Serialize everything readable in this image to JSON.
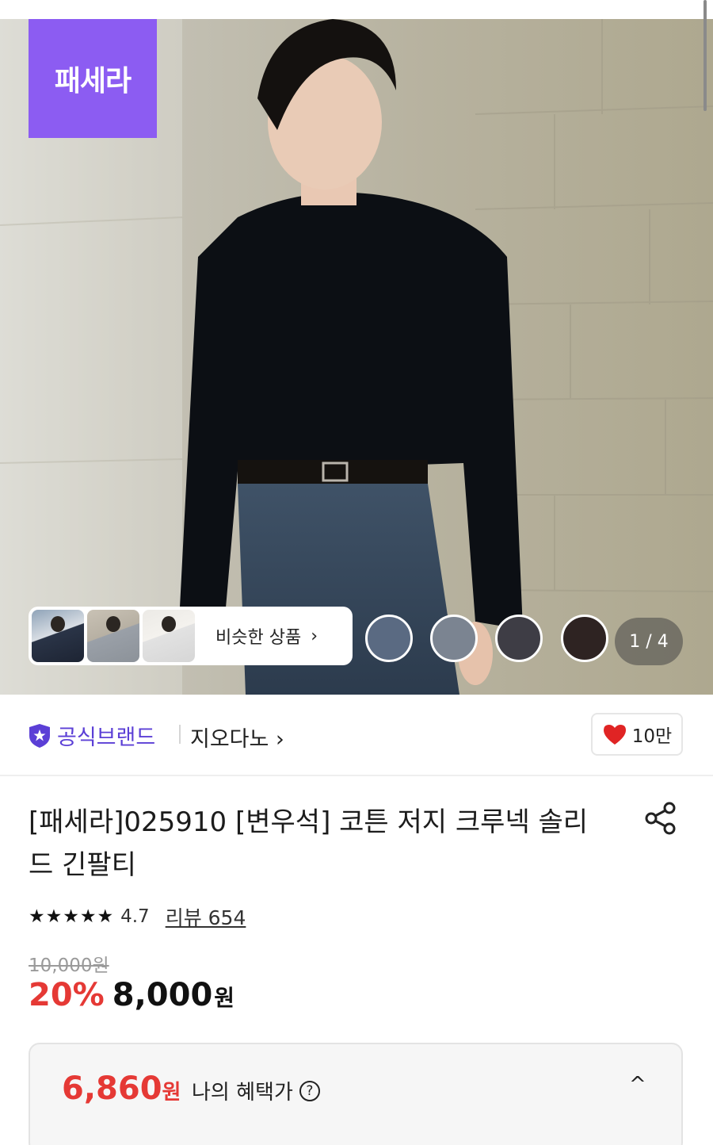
{
  "brand_badge": {
    "text": "패세라",
    "color": "#8c5cf2"
  },
  "similar_products": {
    "label": "비슷한 상품",
    "chevron": "›",
    "thumbnails": [
      "similar-thumb-1",
      "similar-thumb-2",
      "similar-thumb-3"
    ]
  },
  "color_swatches": [
    "#5a6a82",
    "#7b8491",
    "#3e3d45",
    "#2e2322"
  ],
  "image_counter": "1 / 4",
  "brand_row": {
    "official_label": "공식브랜드",
    "brand_name": "지오다노 ›",
    "like_count": "10만"
  },
  "product": {
    "title_line1": "[패세라]025910 [변우석] 코튼 저지 크루넥 솔리",
    "title_line2": "드 긴팔티",
    "stars": "★★★★★",
    "rating": "4.7",
    "review_label": "리뷰 654",
    "original_price": "10,000원",
    "discount": "20%",
    "sale_price": "8,000",
    "currency": "원"
  },
  "benefit": {
    "price": "6,860",
    "currency": "원",
    "label": "나의 혜택가",
    "help_icon": "?",
    "collapse_icon": "^"
  },
  "colors": {
    "accent_red": "#e53935",
    "brand_purple": "#5b3fd6",
    "heart": "#e02424"
  }
}
